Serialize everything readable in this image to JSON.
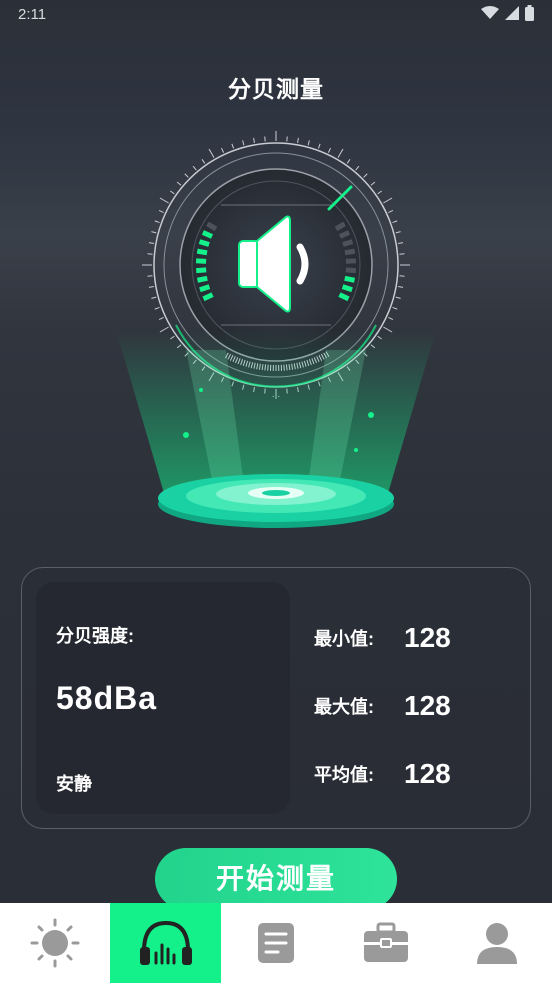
{
  "status": {
    "time": "2:11"
  },
  "header": {
    "title": "分贝测量"
  },
  "colors": {
    "accent": "#14f08a",
    "button": "#22d38c",
    "nav_icon": "#9a9a9a"
  },
  "meter": {
    "strength_label": "分贝强度:",
    "value": "58dBa",
    "status": "安静"
  },
  "stats": [
    {
      "label": "最小值:",
      "value": "128"
    },
    {
      "label": "最大值:",
      "value": "128"
    },
    {
      "label": "平均值:",
      "value": "128"
    }
  ],
  "start_button": {
    "label": "开始测量"
  },
  "nav": {
    "active_index": 1,
    "items": [
      {
        "icon": "sun-icon"
      },
      {
        "icon": "headphones-icon"
      },
      {
        "icon": "document-icon"
      },
      {
        "icon": "toolbox-icon"
      },
      {
        "icon": "user-icon"
      }
    ]
  }
}
